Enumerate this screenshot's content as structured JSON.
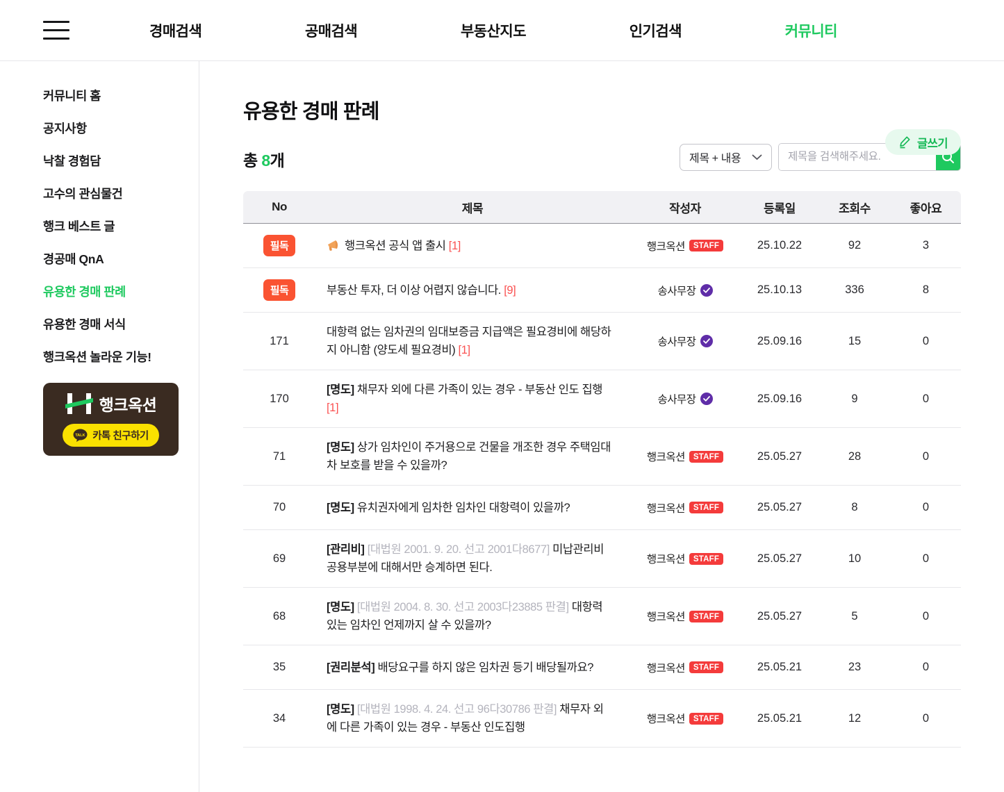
{
  "colors": {
    "accent_green": "#1ec95f",
    "write_button_bg": "#e7f9ee",
    "must_badge_red": "#fa5332",
    "staff_badge_red": "#f43b3b",
    "comment_red": "#fa5252",
    "verified_purple": "#5f2da8",
    "banner_brown": "#3a2b21",
    "kakao_yellow": "#fae100",
    "table_header_bg": "#f1f1f4"
  },
  "topbar": {
    "menu_icon": "hamburger-icon",
    "items": [
      {
        "label": "경매검색",
        "active": false
      },
      {
        "label": "공매검색",
        "active": false
      },
      {
        "label": "부동산지도",
        "active": false
      },
      {
        "label": "인기검색",
        "active": false
      },
      {
        "label": "커뮤니티",
        "active": true
      }
    ]
  },
  "sidebar": {
    "items": [
      {
        "label": "커뮤니티 홈",
        "active": false
      },
      {
        "label": "공지사항",
        "active": false
      },
      {
        "label": "낙찰 경험담",
        "active": false
      },
      {
        "label": "고수의 관심물건",
        "active": false
      },
      {
        "label": "행크 베스트 글",
        "active": false
      },
      {
        "label": "경공매 QnA",
        "active": false
      },
      {
        "label": "유용한 경매 판례",
        "active": true
      },
      {
        "label": "유용한 경매 서식",
        "active": false
      },
      {
        "label": "행크옥션 놀라운 기능!",
        "active": false
      }
    ],
    "banner": {
      "logo_text": "행크옥션",
      "logo_icon": "h-logo-icon",
      "kakao_button_label": "카톡 친구하기",
      "kakao_icon": "kakaotalk-icon"
    }
  },
  "main": {
    "title": "유용한 경매 판례",
    "write_button_label": "글쓰기",
    "total": {
      "prefix": "총 ",
      "count": "8",
      "suffix": "개"
    },
    "search": {
      "filter_value": "제목 + 내용",
      "placeholder": "제목을 검색해주세요."
    },
    "table": {
      "headers": [
        "No",
        "제목",
        "작성자",
        "등록일",
        "조회수",
        "좋아요"
      ],
      "rows": [
        {
          "badge": "필독",
          "icon": "megaphone-icon",
          "title_text": "행크옥션 공식 앱 출시 ",
          "comment": "[1]",
          "author": "행크옥션",
          "author_badge": "STAFF",
          "date": "25.10.22",
          "views": "92",
          "likes": "3"
        },
        {
          "badge": "필독",
          "title_text": "부동산 투자, 더 이상 어렵지 않습니다. ",
          "comment": "[9]",
          "author": "송사무장",
          "author_badge": "verified",
          "date": "25.10.13",
          "views": "336",
          "likes": "8"
        },
        {
          "no": "171",
          "title_text": "대항력 없는 임차권의 임대보증금 지급액은 필요경비에 해당하지 아니함 (양도세 필요경비) ",
          "comment": "[1]",
          "author": "송사무장",
          "author_badge": "verified",
          "date": "25.09.16",
          "views": "15",
          "likes": "0"
        },
        {
          "no": "170",
          "title_bold": "[명도]",
          "title_text": " 채무자 외에 다른 가족이 있는 경우 - 부동산 인도 집행 ",
          "comment": "[1]",
          "author": "송사무장",
          "author_badge": "verified",
          "date": "25.09.16",
          "views": "9",
          "likes": "0"
        },
        {
          "no": "71",
          "title_bold": "[명도]",
          "title_text": " 상가 임차인이 주거용으로 건물을 개조한 경우 주택임대차 보호를 받을 수 있을까?",
          "author": "행크옥션",
          "author_badge": "STAFF",
          "date": "25.05.27",
          "views": "28",
          "likes": "0"
        },
        {
          "no": "70",
          "title_bold": "[명도]",
          "title_text": " 유치권자에게 임차한 임차인 대항력이 있을까?",
          "author": "행크옥션",
          "author_badge": "STAFF",
          "date": "25.05.27",
          "views": "8",
          "likes": "0"
        },
        {
          "no": "69",
          "title_bold": "[관리비]",
          "title_gray": " [대법원 2001. 9. 20. 선고 2001다8677]",
          "title_text": " 미납관리비 공용부분에 대해서만 승계하면 된다.",
          "author": "행크옥션",
          "author_badge": "STAFF",
          "date": "25.05.27",
          "views": "10",
          "likes": "0"
        },
        {
          "no": "68",
          "title_bold": "[명도]",
          "title_gray": " [대법원 2004. 8. 30. 선고 2003다23885 판결]",
          "title_text": " 대항력 있는 임차인 언제까지 살 수 있을까?",
          "author": "행크옥션",
          "author_badge": "STAFF",
          "date": "25.05.27",
          "views": "5",
          "likes": "0"
        },
        {
          "no": "35",
          "title_bold": "[권리분석]",
          "title_text": " 배당요구를 하지 않은 임차권 등기 배당될까요?",
          "author": "행크옥션",
          "author_badge": "STAFF",
          "date": "25.05.21",
          "views": "23",
          "likes": "0"
        },
        {
          "no": "34",
          "title_bold": "[명도]",
          "title_gray": " [대법원 1998. 4. 24. 선고 96다30786 판결]",
          "title_text": " 채무자 외에 다른 가족이 있는 경우 - 부동산 인도집행",
          "author": "행크옥션",
          "author_badge": "STAFF",
          "date": "25.05.21",
          "views": "12",
          "likes": "0"
        }
      ]
    }
  }
}
